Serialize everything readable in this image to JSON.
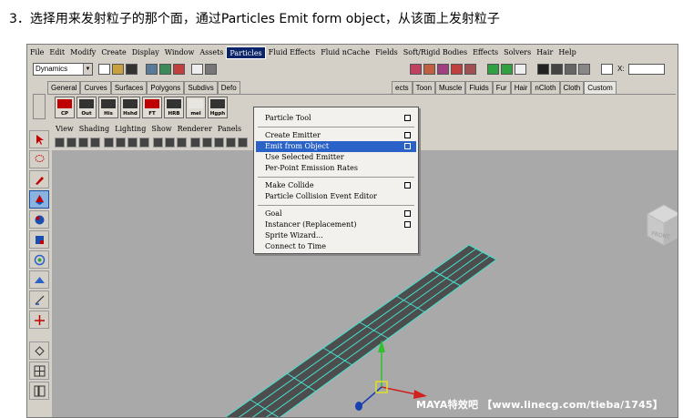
{
  "caption": "3．选择用来发射粒子的那个面，通过Particles Emit form object，从该面上发射粒子",
  "menubar": [
    "File",
    "Edit",
    "Modify",
    "Create",
    "Display",
    "Window",
    "Assets",
    "Particles",
    "Fluid Effects",
    "Fluid nCache",
    "Fields",
    "Soft/Rigid Bodies",
    "Effects",
    "Solvers",
    "Hair",
    "Help"
  ],
  "active_menu": "Particles",
  "status_line": {
    "mode": "Dynamics",
    "x_label": "X:"
  },
  "shelf": {
    "tabs_left": [
      "General",
      "Curves",
      "Surfaces",
      "Polygons",
      "Subdivs",
      "Defo"
    ],
    "tabs_right": [
      "ects",
      "Toon",
      "Muscle",
      "Fluids",
      "Fur",
      "Hair",
      "nCloth",
      "Cloth",
      "Custom"
    ],
    "active_tab": "Custom",
    "buttons": [
      {
        "label": "CP",
        "icon": "cp-icon"
      },
      {
        "label": "Out",
        "icon": "out-icon"
      },
      {
        "label": "His",
        "icon": "his-icon"
      },
      {
        "label": "Hshd",
        "icon": "hshd-icon"
      },
      {
        "label": "FT",
        "icon": "ft-icon"
      },
      {
        "label": "HRB",
        "icon": "hrb-icon"
      },
      {
        "label": "mel",
        "icon": "mel-icon"
      },
      {
        "label": "Hgph",
        "icon": "hgph-icon"
      }
    ]
  },
  "panel_menu": [
    "View",
    "Shading",
    "Lighting",
    "Show",
    "Renderer",
    "Panels"
  ],
  "particles_menu": {
    "items": [
      {
        "label": "Particle Tool",
        "option_box": true,
        "highlighted": false
      },
      {
        "label": "Create Emitter",
        "option_box": true,
        "highlighted": false
      },
      {
        "label": "Emit from Object",
        "option_box": true,
        "highlighted": true
      },
      {
        "label": "Use Selected Emitter",
        "option_box": false,
        "highlighted": false
      },
      {
        "label": "Per-Point Emission Rates",
        "option_box": false,
        "highlighted": false
      },
      {
        "label": "Make Collide",
        "option_box": true,
        "highlighted": false
      },
      {
        "label": "Particle Collision Event Editor",
        "option_box": false,
        "highlighted": false
      },
      {
        "label": "Goal",
        "option_box": true,
        "highlighted": false
      },
      {
        "label": "Instancer (Replacement)",
        "option_box": true,
        "highlighted": false
      },
      {
        "label": "Sprite Wizard...",
        "option_box": false,
        "highlighted": false
      },
      {
        "label": "Connect to Time",
        "option_box": false,
        "highlighted": false
      }
    ]
  },
  "viewcube": {
    "face_label": "FRONT"
  },
  "watermark": "MAYA特效吧 【www.linecg.com/tieba/1745】",
  "colors": {
    "viewport_bg": "#a9a9a9",
    "mesh_fill": "#4d4d4d",
    "wire": "#45e0d0",
    "highlight": "#2a62c8"
  }
}
